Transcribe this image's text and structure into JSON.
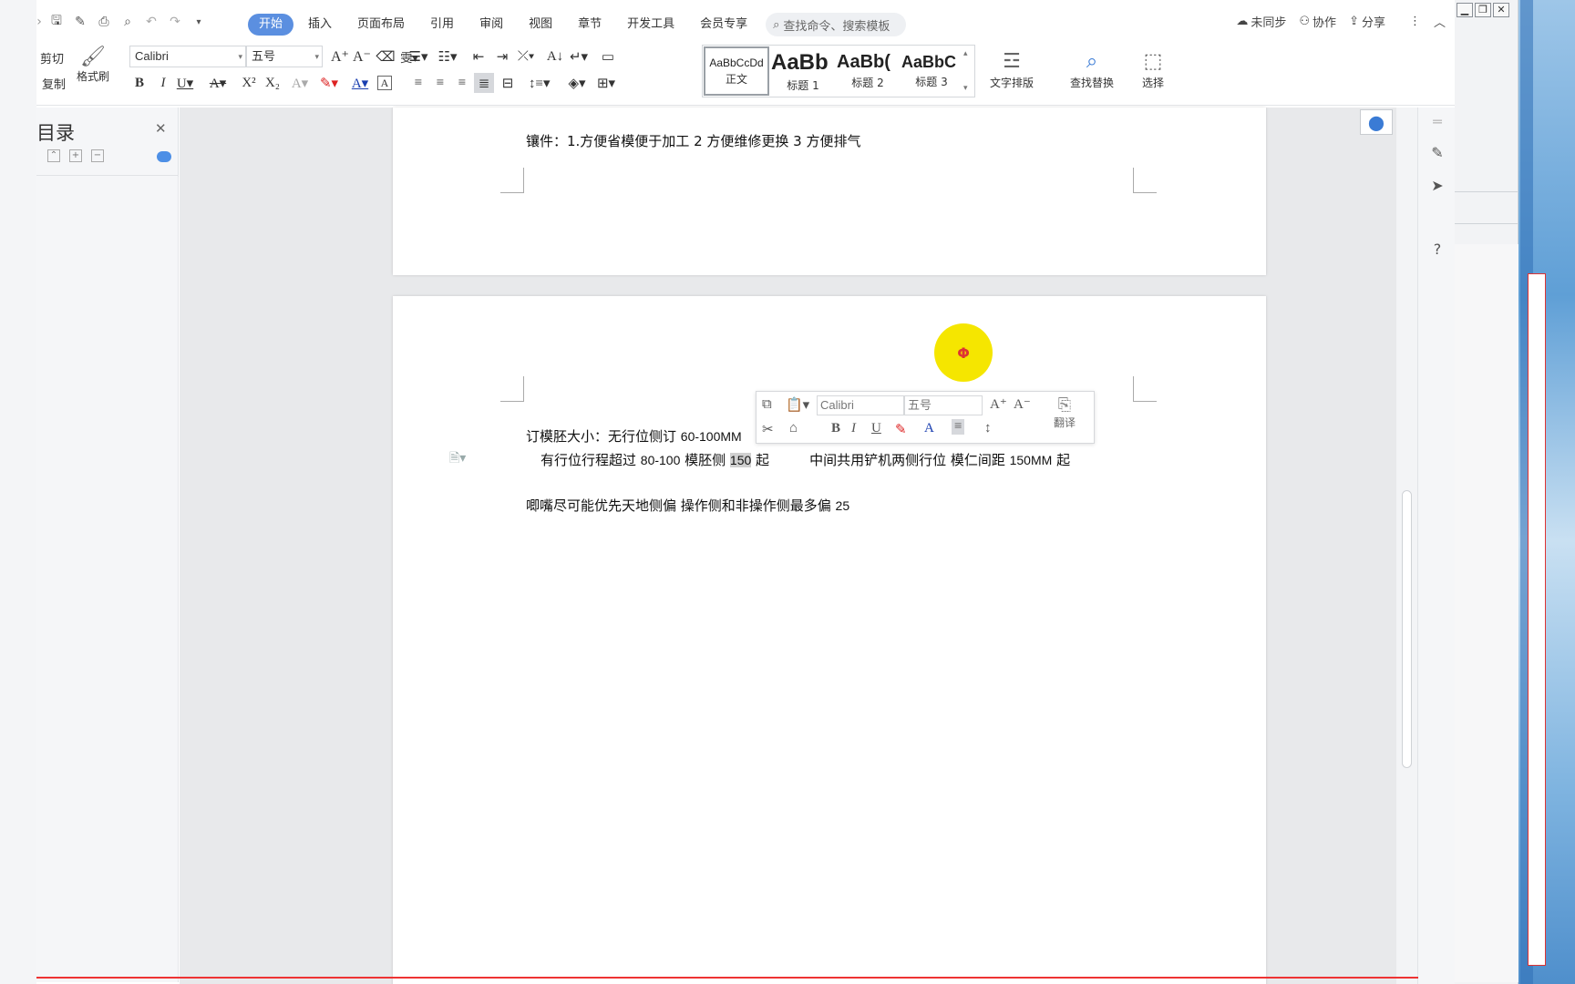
{
  "ribbon_tabs": [
    "开始",
    "插入",
    "页面布局",
    "引用",
    "审阅",
    "视图",
    "章节",
    "开发工具",
    "会员专享"
  ],
  "search_placeholder": "查找命令、搜索模板",
  "right_actions": {
    "sync": "未同步",
    "collab": "协作",
    "share": "分享"
  },
  "clipboard": {
    "cut": "剪切",
    "copy": "复制",
    "format_painter": "格式刷"
  },
  "font": {
    "name": "Calibri",
    "size": "五号"
  },
  "styles": [
    {
      "sample": "AaBbCcDd",
      "name": "正文"
    },
    {
      "sample": "AaBb",
      "name": "标题 1"
    },
    {
      "sample": "AaBb(",
      "name": "标题 2"
    },
    {
      "sample": "AaBbC",
      "name": "标题 3"
    }
  ],
  "big_buttons": {
    "text_layout": "文字排版",
    "find_replace": "查找替换",
    "select": "选择"
  },
  "nav": {
    "title": "目录"
  },
  "doc": {
    "line_top": "镶件：1.方便省模便于加工   2 方便维修更换  3 方便排气",
    "line1_a": "订模胚大小：无行位侧订 ",
    "line1_b": "60-100MM",
    "line2_a": "有行位行程超过 ",
    "line2_b": "80-100",
    "line2_c": " 模胚侧 ",
    "line2_d": "150",
    "line2_e": " 起",
    "line2_f": "中间共用铲机两侧行位  模仁间距 ",
    "line2_g": "150MM",
    "line2_h": " 起",
    "line3_a": "唧嘴尽可能优先天地侧偏   操作侧和非操作侧最多偏 ",
    "line3_b": "25"
  },
  "mini_toolbar": {
    "font": "Calibri",
    "size": "五号",
    "translate": "翻译"
  },
  "cursor_glyph": "Φ"
}
